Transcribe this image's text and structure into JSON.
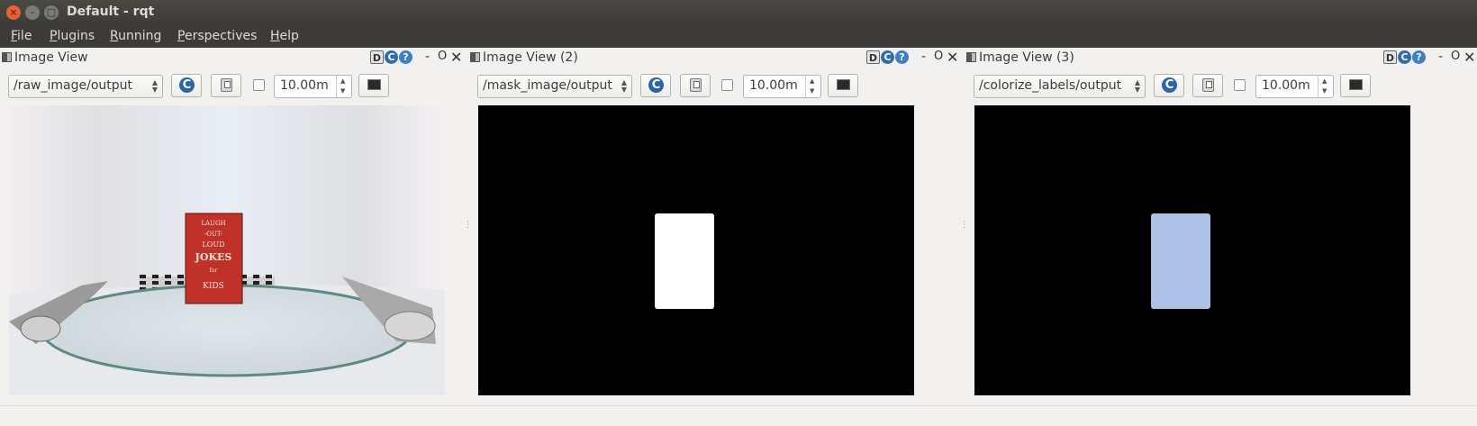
{
  "window": {
    "title": "Default - rqt",
    "close_glyph": "×",
    "min_glyph": "–",
    "max_glyph": "□"
  },
  "menubar": {
    "items": [
      "File",
      "Plugins",
      "Running",
      "Perspectives",
      "Help"
    ]
  },
  "panels": [
    {
      "title": "Image View",
      "topic": "/raw_image/output",
      "checked": false,
      "timeout": "10.00m"
    },
    {
      "title": "Image View (2)",
      "topic": "/mask_image/output",
      "checked": false,
      "timeout": "10.00m"
    },
    {
      "title": "Image View (3)",
      "topic": "/colorize_labels/output",
      "checked": false,
      "timeout": "10.00m"
    }
  ],
  "panel_header_icons": {
    "dock": "D",
    "reload": "C",
    "help": "?",
    "minimize": "-",
    "float": "O",
    "close": "✕"
  },
  "raw_image_book": {
    "lines": [
      "LAUGH",
      "-OUT-",
      "LOUD",
      "JOKES",
      "for",
      "KIDS"
    ]
  },
  "colors": {
    "titlebar": "#3c3b37",
    "mask_blob": "#ffffff",
    "label_blob": "#adc3e6",
    "book_red": "#c0312a"
  }
}
